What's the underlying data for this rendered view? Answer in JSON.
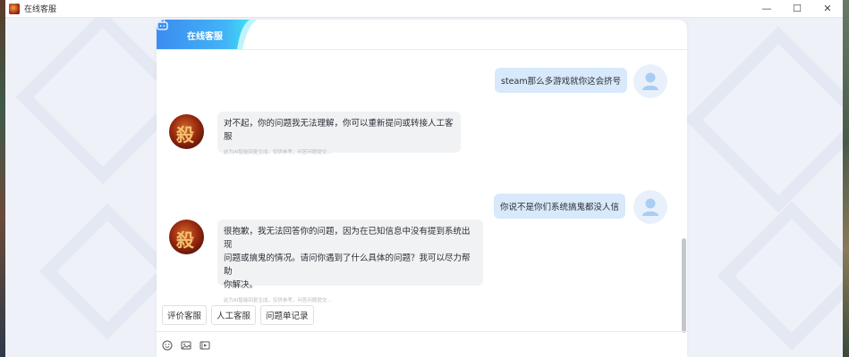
{
  "window": {
    "title": "在线客服",
    "minimize_glyph": "—",
    "maximize_glyph": "☐",
    "close_glyph": "✕"
  },
  "header": {
    "tab_label": "在线客服",
    "tab_icon": "robot-icon"
  },
  "colors": {
    "tab_gradient_start": "#3b8cf0",
    "tab_gradient_end": "#3fe0f5",
    "user_bubble": "#d7e9fa",
    "bot_bubble": "#f1f2f4"
  },
  "messages": [
    {
      "role": "user",
      "text": "steam那么多游戏就你这会挤号"
    },
    {
      "role": "bot",
      "text": "对不起，你的问题我无法理解，你可以重新提问或转接人工客服",
      "note": "此为AI智能回复生成，仅供参考，问答问题提交..."
    },
    {
      "role": "user",
      "text": "你说不是你们系统搞鬼都没人信"
    },
    {
      "role": "bot",
      "text_lines": [
        "很抱歉，我无法回答你的问题，因为在已知信息中没有提到系统出现",
        "问题或搞鬼的情况。请问你遇到了什么具体的问题？我可以尽力帮助",
        "你解决。"
      ],
      "note": "此为AI智能回复生成，仅供参考，问答问题提交..."
    }
  ],
  "quick_actions": [
    "评价客服",
    "人工客服",
    "问题单记录"
  ],
  "toolbar_icons": [
    "emoji-icon",
    "image-icon",
    "video-icon"
  ]
}
